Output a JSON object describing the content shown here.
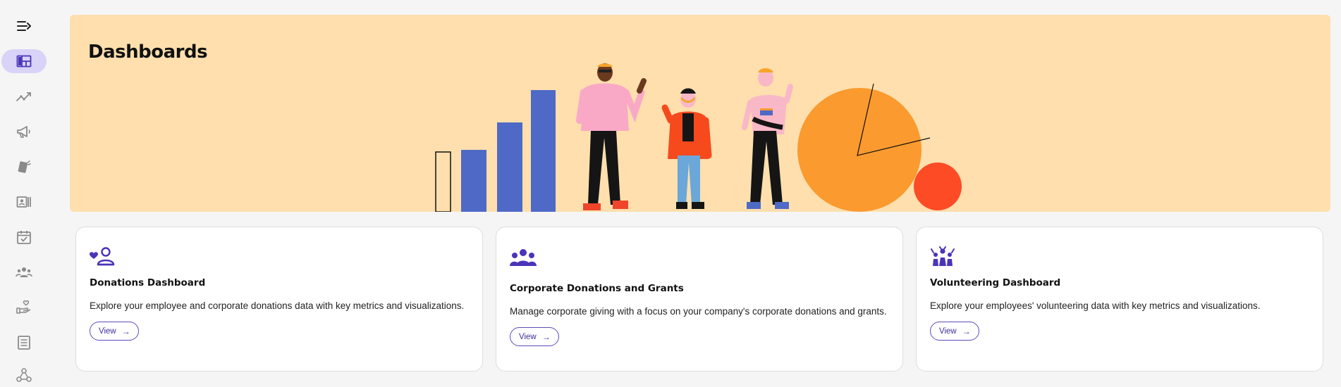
{
  "sidebar": {
    "items": [
      {
        "name": "collapse",
        "icon": "menu-collapse-icon"
      },
      {
        "name": "dashboards",
        "icon": "dashboard-icon",
        "active": true
      },
      {
        "name": "trends",
        "icon": "trend-line-icon"
      },
      {
        "name": "campaigns",
        "icon": "megaphone-icon"
      },
      {
        "name": "cards",
        "icon": "cards-icon"
      },
      {
        "name": "profiles",
        "icon": "profile-card-icon"
      },
      {
        "name": "calendar",
        "icon": "calendar-check-icon"
      },
      {
        "name": "people",
        "icon": "people-group-icon"
      },
      {
        "name": "giving",
        "icon": "hand-heart-icon"
      },
      {
        "name": "documents",
        "icon": "document-list-icon"
      },
      {
        "name": "network",
        "icon": "network-nodes-icon"
      }
    ]
  },
  "hero": {
    "title": "Dashboards",
    "background": "#fedfad"
  },
  "cards": [
    {
      "title": "Donations Dashboard",
      "description": "Explore your employee and corporate donations data with key metrics and visualizations.",
      "button": "View",
      "icon": "heart-person-icon"
    },
    {
      "title": "Corporate Donations and Grants",
      "description": "Manage corporate giving with a focus on your company's corporate donations and grants.",
      "button": "View",
      "icon": "people-group-icon"
    },
    {
      "title": "Volunteering Dashboard",
      "description": "Explore your employees' volunteering data with key metrics and visualizations.",
      "button": "View",
      "icon": "volunteers-icon"
    }
  ],
  "colors": {
    "accent": "#5b3fc4",
    "active_nav_bg": "#d8d3f7",
    "bar_blue": "#4f69c6",
    "pie_orange": "#fb9a2e",
    "circle_red": "#fd4b26"
  }
}
